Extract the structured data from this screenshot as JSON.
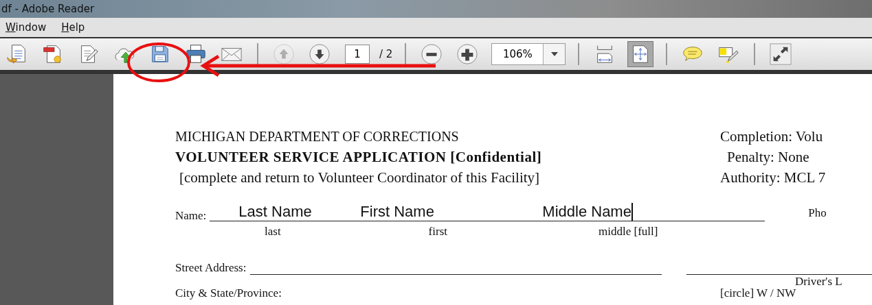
{
  "window": {
    "title": "df - Adobe Reader"
  },
  "menu": [
    {
      "label": "Window"
    },
    {
      "label": "Help"
    }
  ],
  "toolbar": {
    "file_tools": [
      {
        "disabled": false
      },
      {
        "disabled": false
      },
      {
        "disabled": false
      },
      {
        "disabled": false
      },
      {
        "disabled": false
      },
      {
        "disabled": false
      },
      {
        "disabled": false
      }
    ],
    "prev_page": {
      "disabled": true
    },
    "next_page": {
      "disabled": false
    },
    "page_number": "1",
    "page_count": "/ 2",
    "zoom_out": {
      "disabled": false
    },
    "zoom_in": {
      "disabled": false
    },
    "zoom_value": "106%",
    "view_modes": [
      {
        "selected": false
      },
      {
        "selected": true
      }
    ],
    "comment_tools": [
      {
        "disabled": false
      },
      {
        "disabled": false
      }
    ],
    "full_screen": {
      "disabled": false
    }
  },
  "document": {
    "header_left": [
      "MICHIGAN DEPARTMENT OF CORRECTIONS",
      "VOLUNTEER SERVICE APPLICATION [Confidential]",
      "[complete and return to Volunteer Coordinator of this Facility]"
    ],
    "header_right": [
      "Completion: Volu",
      "Penalty: None",
      "Authority: MCL 7"
    ],
    "name_label": "Name:",
    "name_fields": [
      {
        "value": "Last Name",
        "caption": "last"
      },
      {
        "value": "First Name",
        "caption": "first"
      },
      {
        "value": "Middle Name",
        "caption": "middle [full]"
      }
    ],
    "phone_label": "Pho",
    "street_label": "Street Address:",
    "license_label": "Driver's L",
    "city_label": "City & State/Province:",
    "circle_label": "[circle]  W / NW"
  }
}
